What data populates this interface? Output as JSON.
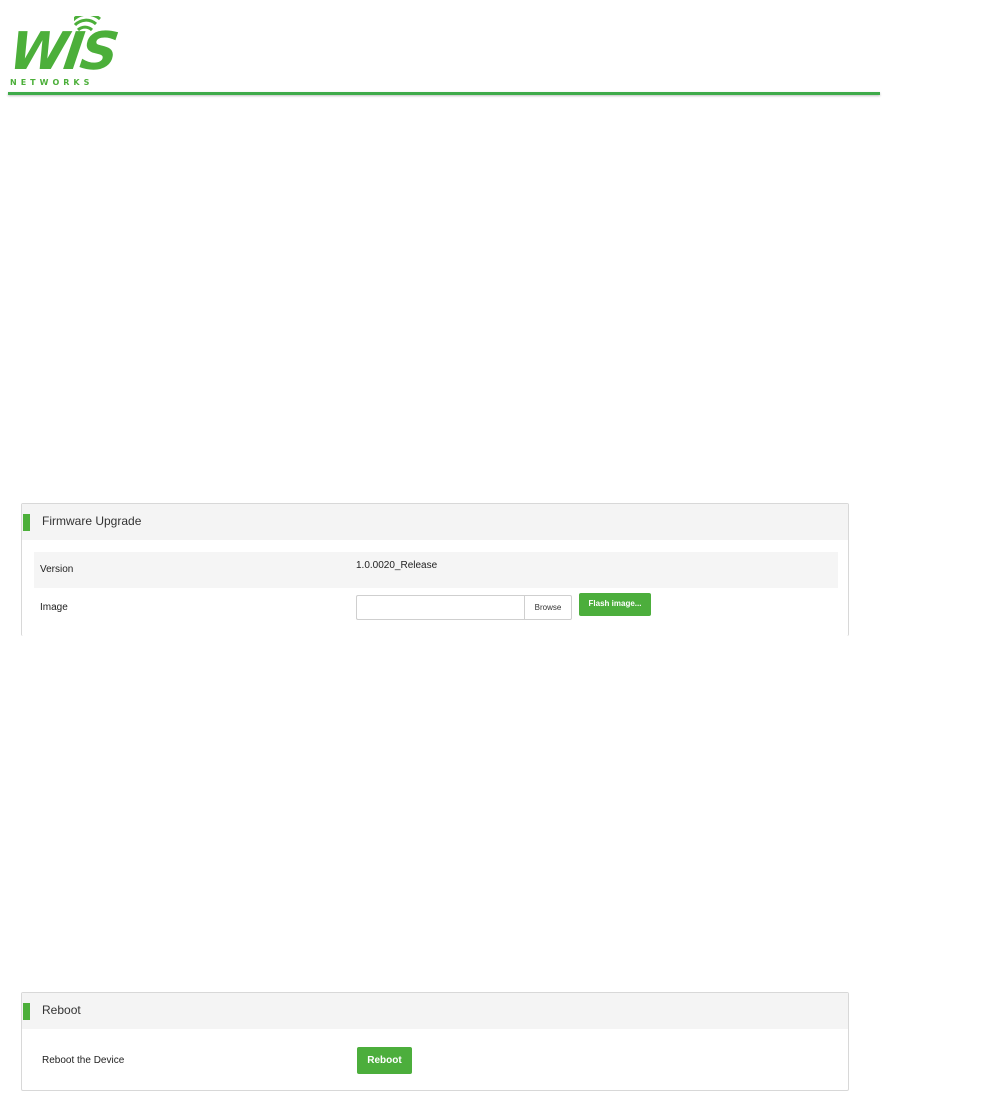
{
  "logo": {
    "word": "WIS",
    "subtitle": "NETWORKS",
    "brand_color": "#4caf3a"
  },
  "firmware_panel": {
    "title": "Firmware Upgrade",
    "version_label": "Version",
    "version_value": "1.0.0020_Release",
    "image_label": "Image",
    "image_value": "",
    "browse_label": "Browse",
    "flash_label": "Flash image..."
  },
  "reboot_panel": {
    "title": "Reboot",
    "row_label": "Reboot the Device",
    "button_label": "Reboot"
  },
  "colors": {
    "accent": "#4cae3c",
    "header_rule": "#3fab4a",
    "panel_header_bg": "#f4f4f4"
  }
}
